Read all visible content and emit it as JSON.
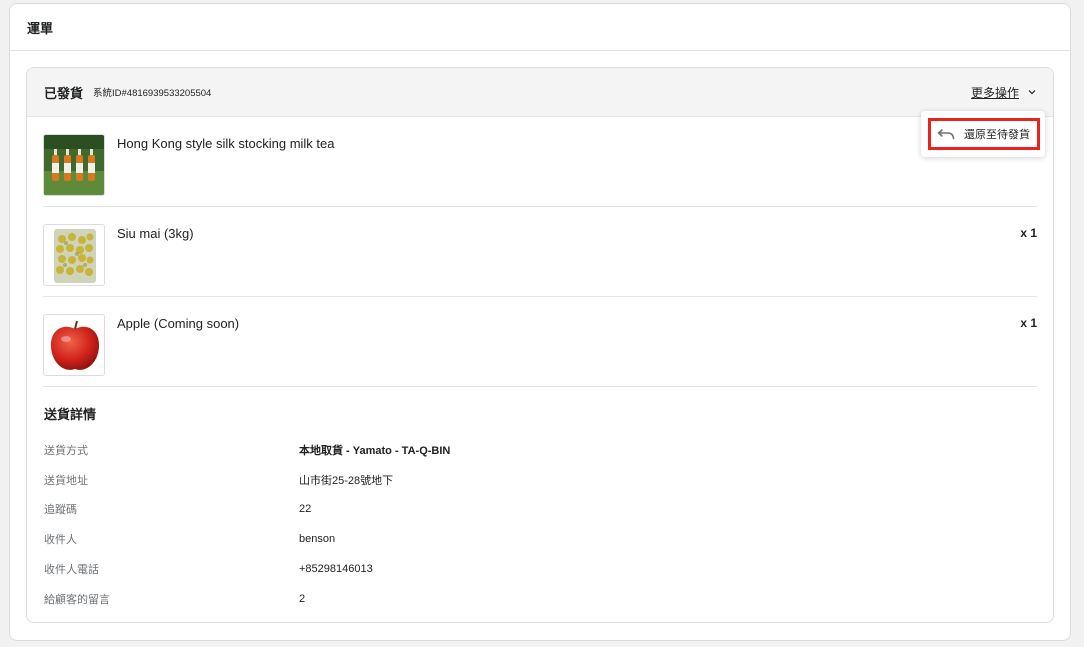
{
  "section": {
    "title": "運單"
  },
  "shipment": {
    "status": "已發貨",
    "system_id": "系統ID#4816939533205504",
    "more_actions_label": "更多操作"
  },
  "popover": {
    "revert_label": "還原至待發貨"
  },
  "items": [
    {
      "name": "Hong Kong style silk stocking milk tea",
      "qty": ""
    },
    {
      "name": "Siu mai (3kg)",
      "qty": "x 1"
    },
    {
      "name": "Apple (Coming soon)",
      "qty": "x 1"
    }
  ],
  "delivery": {
    "title": "送貨詳情",
    "rows": [
      {
        "label": "送貨方式",
        "value": "本地取貨 - Yamato - TA-Q-BIN"
      },
      {
        "label": "送貨地址",
        "value": "山市街25-28號地下"
      },
      {
        "label": "追蹤碼",
        "value": "22"
      },
      {
        "label": "收件人",
        "value": "benson"
      },
      {
        "label": "收件人電話",
        "value": "+85298146013"
      },
      {
        "label": "給顧客的留言",
        "value": "2"
      }
    ]
  },
  "colors": {
    "highlight": "#e8231b",
    "header_bg": "#f4f4f4"
  }
}
